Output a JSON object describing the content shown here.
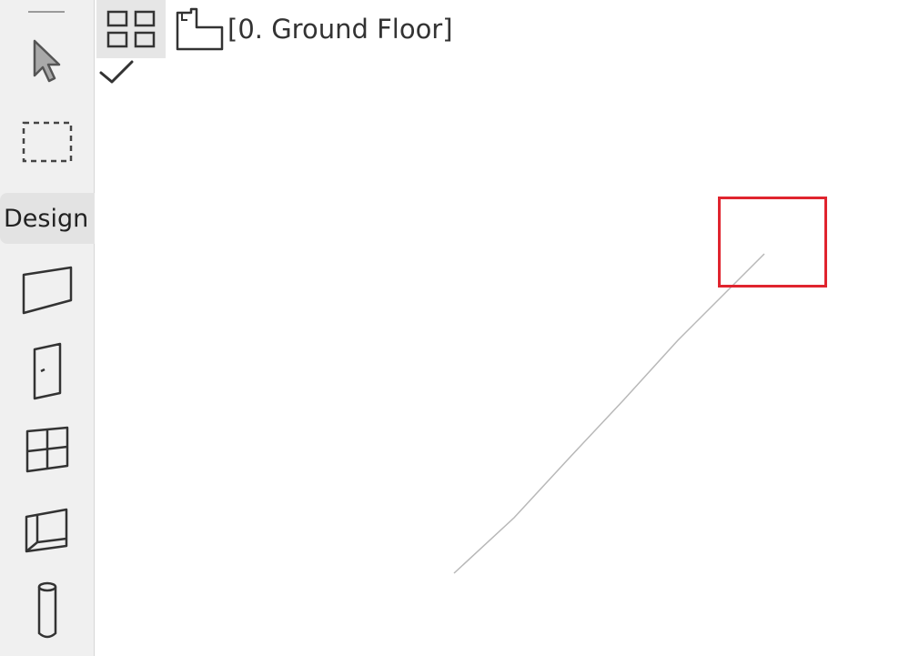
{
  "floor_tab": {
    "label": "[0. Ground Floor]"
  },
  "toolbox": {
    "group_label": "Design",
    "tools": [
      "arrow-tool",
      "marquee-tool",
      "wall-tool",
      "door-tool",
      "window-tool",
      "skylight-tool",
      "column-tool"
    ]
  },
  "colors": {
    "highlight": "#e0242e",
    "toolbar_bg": "#f0f0f0",
    "line": "#b8b8b8"
  }
}
